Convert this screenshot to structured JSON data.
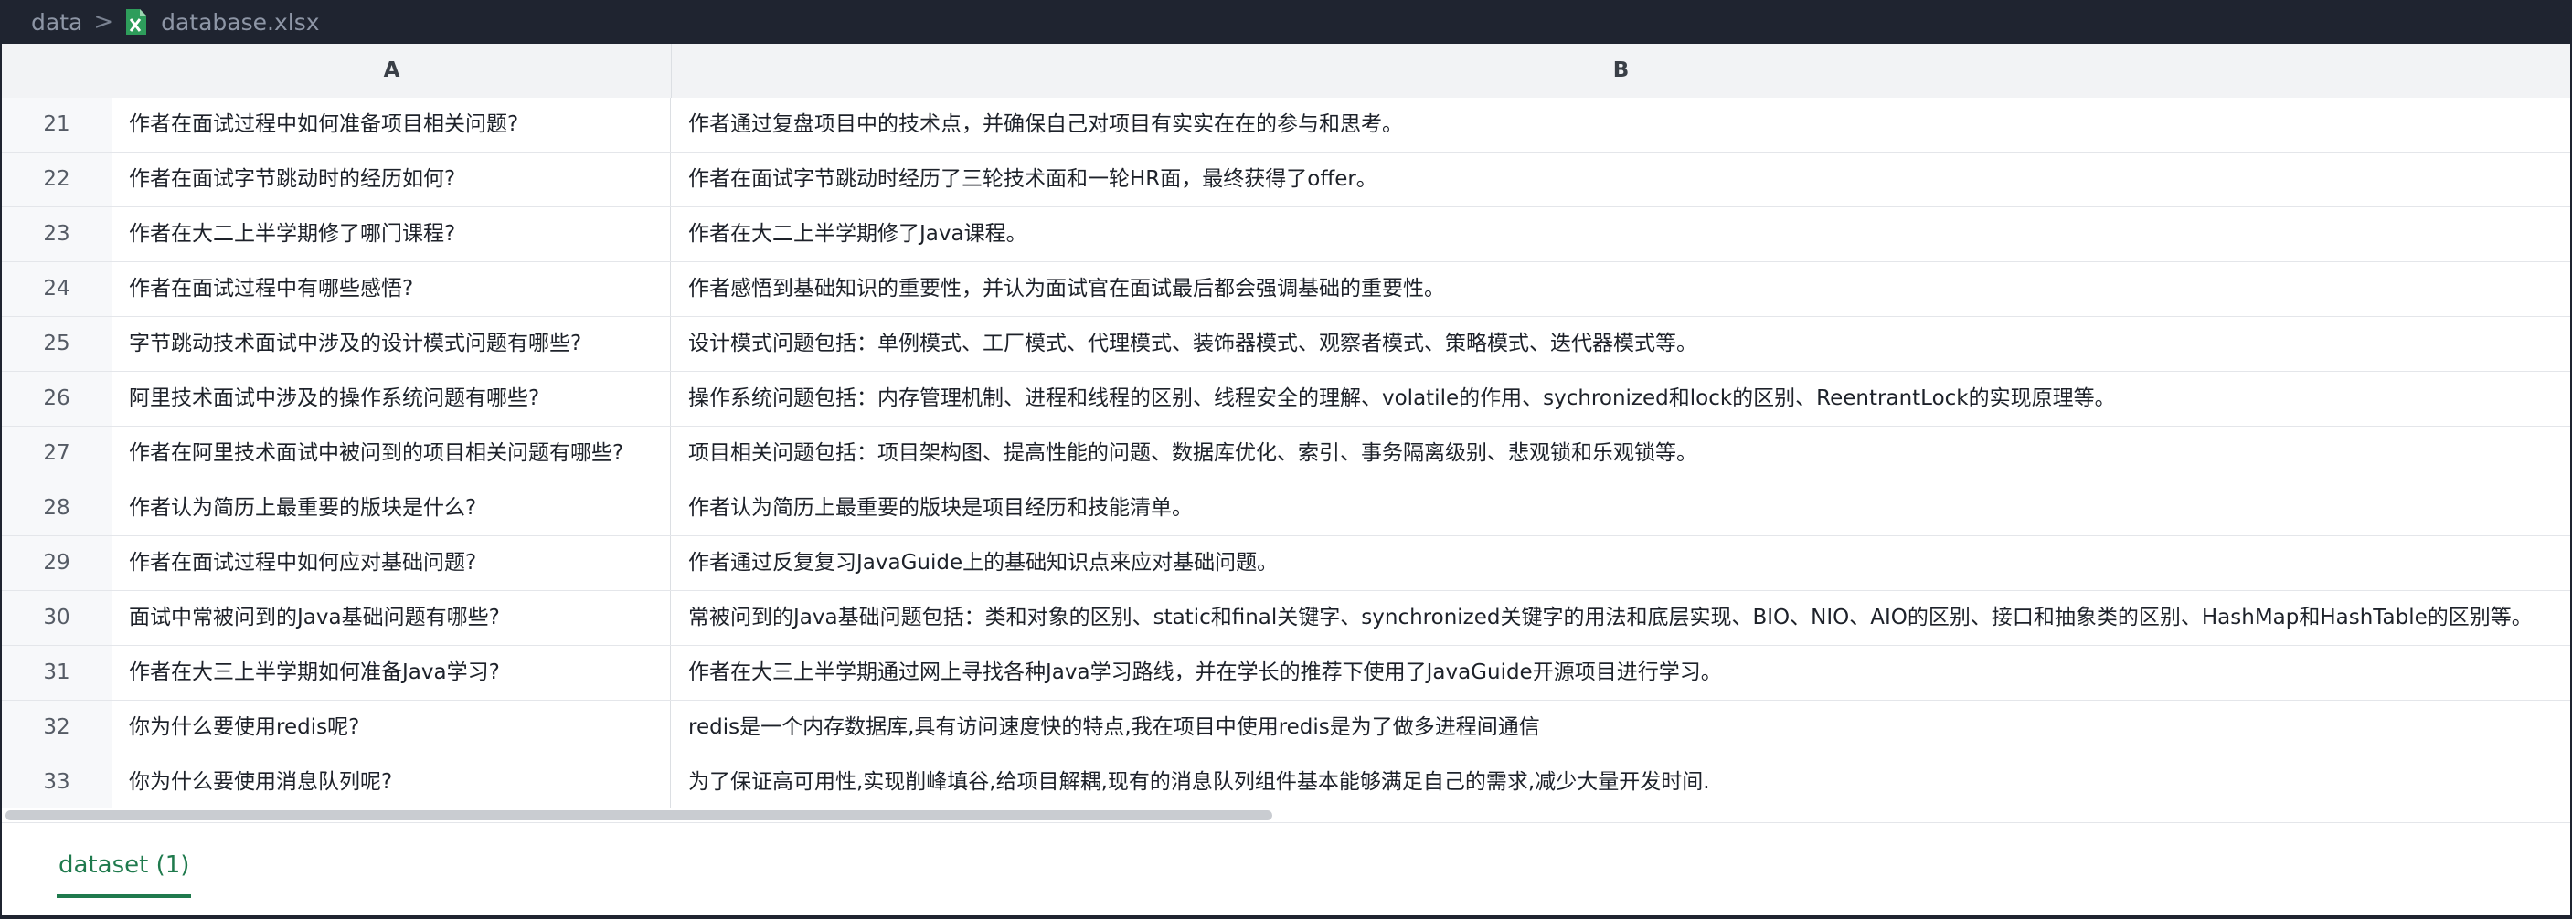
{
  "breadcrumb": {
    "root": "data",
    "separator": ">",
    "file": "database.xlsx",
    "file_icon": "excel-file-icon"
  },
  "columns": {
    "a": "A",
    "b": "B"
  },
  "rows": [
    {
      "num": "21",
      "a": "作者在面试过程中如何准备项目相关问题?",
      "b": "作者通过复盘项目中的技术点，并确保自己对项目有实实在在的参与和思考。"
    },
    {
      "num": "22",
      "a": "作者在面试字节跳动时的经历如何?",
      "b": "作者在面试字节跳动时经历了三轮技术面和一轮HR面，最终获得了offer。"
    },
    {
      "num": "23",
      "a": "作者在大二上半学期修了哪门课程?",
      "b": "作者在大二上半学期修了Java课程。"
    },
    {
      "num": "24",
      "a": "作者在面试过程中有哪些感悟?",
      "b": "作者感悟到基础知识的重要性，并认为面试官在面试最后都会强调基础的重要性。"
    },
    {
      "num": "25",
      "a": "字节跳动技术面试中涉及的设计模式问题有哪些?",
      "b": "设计模式问题包括：单例模式、工厂模式、代理模式、装饰器模式、观察者模式、策略模式、迭代器模式等。"
    },
    {
      "num": "26",
      "a": "阿里技术面试中涉及的操作系统问题有哪些?",
      "b": "操作系统问题包括：内存管理机制、进程和线程的区别、线程安全的理解、volatile的作用、sychronized和lock的区别、ReentrantLock的实现原理等。"
    },
    {
      "num": "27",
      "a": "作者在阿里技术面试中被问到的项目相关问题有哪些?",
      "b": "项目相关问题包括：项目架构图、提高性能的问题、数据库优化、索引、事务隔离级别、悲观锁和乐观锁等。"
    },
    {
      "num": "28",
      "a": "作者认为简历上最重要的版块是什么?",
      "b": "作者认为简历上最重要的版块是项目经历和技能清单。"
    },
    {
      "num": "29",
      "a": "作者在面试过程中如何应对基础问题?",
      "b": "作者通过反复复习JavaGuide上的基础知识点来应对基础问题。"
    },
    {
      "num": "30",
      "a": "面试中常被问到的Java基础问题有哪些?",
      "b": "常被问到的Java基础问题包括：类和对象的区别、static和final关键字、synchronized关键字的用法和底层实现、BIO、NIO、AIO的区别、接口和抽象类的区别、HashMap和HashTable的区别等。"
    },
    {
      "num": "31",
      "a": "作者在大三上半学期如何准备Java学习?",
      "b": "作者在大三上半学期通过网上寻找各种Java学习路线，并在学长的推荐下使用了JavaGuide开源项目进行学习。"
    },
    {
      "num": "32",
      "a": "你为什么要使用redis呢?",
      "b": "redis是一个内存数据库,具有访问速度快的特点,我在项目中使用redis是为了做多进程间通信"
    },
    {
      "num": "33",
      "a": "你为什么要使用消息队列呢?",
      "b": "为了保证高可用性,实现削峰填谷,给项目解耦,现有的消息队列组件基本能够满足自己的需求,减少大量开发时间."
    }
  ],
  "tabs": [
    {
      "label": "dataset (1)",
      "active": true
    }
  ],
  "colors": {
    "accent": "#1f7a4d",
    "topbar_bg": "#1f2430"
  }
}
